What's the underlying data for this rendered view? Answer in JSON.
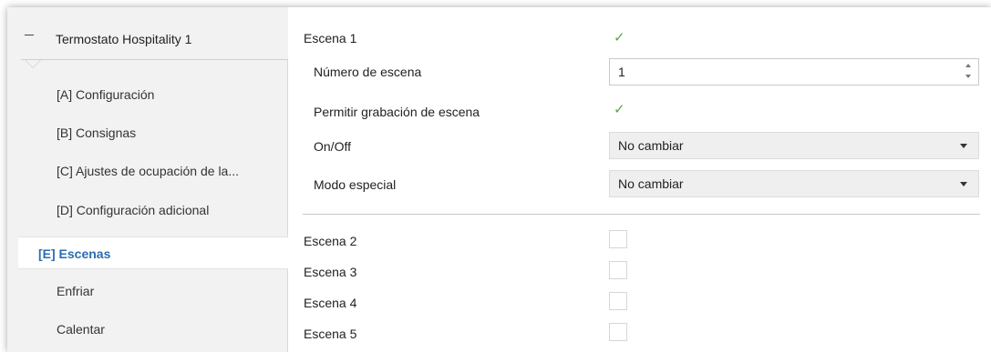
{
  "sidebar": {
    "title": "Termostato Hospitality 1",
    "items": [
      {
        "label": "[A] Configuración"
      },
      {
        "label": "[B] Consignas"
      },
      {
        "label": "[C] Ajustes de ocupación de la..."
      },
      {
        "label": "[D] Configuración adicional"
      },
      {
        "label": "[E] Escenas"
      },
      {
        "label": "Enfriar"
      },
      {
        "label": "Calentar"
      }
    ],
    "active_color": "#2b6cb0"
  },
  "main": {
    "scene1": {
      "label": "Escena 1",
      "checked": true
    },
    "scene_number": {
      "label": "Número de escena",
      "value": "1"
    },
    "allow_record": {
      "label": "Permitir grabación de escena",
      "checked": true
    },
    "onoff": {
      "label": "On/Off",
      "value": "No cambiar"
    },
    "special_mode": {
      "label": "Modo especial",
      "value": "No cambiar"
    },
    "scenes": [
      {
        "label": "Escena 2",
        "checked": false
      },
      {
        "label": "Escena 3",
        "checked": false
      },
      {
        "label": "Escena 4",
        "checked": false
      },
      {
        "label": "Escena 5",
        "checked": false
      }
    ]
  },
  "icons": {
    "check": "checkmark-icon",
    "collapse": "minus-icon"
  }
}
